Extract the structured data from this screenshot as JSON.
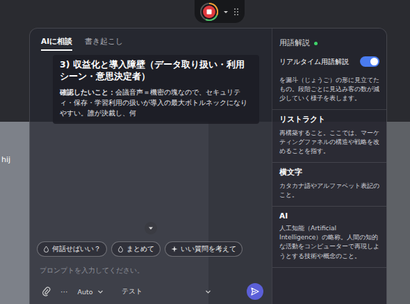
{
  "participant": {
    "name": "hij"
  },
  "tabs": [
    {
      "label": "AIに相談",
      "selected": true
    },
    {
      "label": "書き起こし",
      "selected": false
    }
  ],
  "answer": {
    "heading": "3) 収益化と導入障壁（データ取り扱い・利用シーン・意思決定者）",
    "label": "確認したいこと：",
    "body": "会議音声＝機密の塊なので、セキュリティ・保存・学習利用の扱いが導入の最大ボトルネックになりやすい。誰が決裁し、何"
  },
  "suggestions": [
    {
      "label": "何話せばいい？",
      "kind": "drop"
    },
    {
      "label": "まとめて",
      "kind": "drop"
    },
    {
      "label": "いい質問を考えて",
      "kind": "sparkle"
    }
  ],
  "prompt": {
    "placeholder": "プロンプトを入力してください。"
  },
  "bottom_bar": {
    "more": "···",
    "mode": "Auto",
    "preset": "テスト"
  },
  "glossary": {
    "title": "用語解説",
    "indicator_on": true,
    "toggle_label": "リアルタイム用語解説",
    "realtime_on": true,
    "entries": [
      {
        "desc": "を漏斗（じょうご）の形に見立てたもの。段階ごとに見込み客の数が減少していく様子を表します。"
      },
      {
        "term": "リストラクト",
        "desc": "再構築すること。ここでは、マーケティングファネルの構造や戦略を改めることを指す。"
      },
      {
        "term": "横文字",
        "desc": "カタカナ語やアルファベット表記のこと。"
      },
      {
        "term": "AI",
        "desc": "人工知能（Artificial Intelligence）の略称。人間の知的な活動をコンピューターで再現しようとする技術や概念のこと。"
      }
    ]
  }
}
